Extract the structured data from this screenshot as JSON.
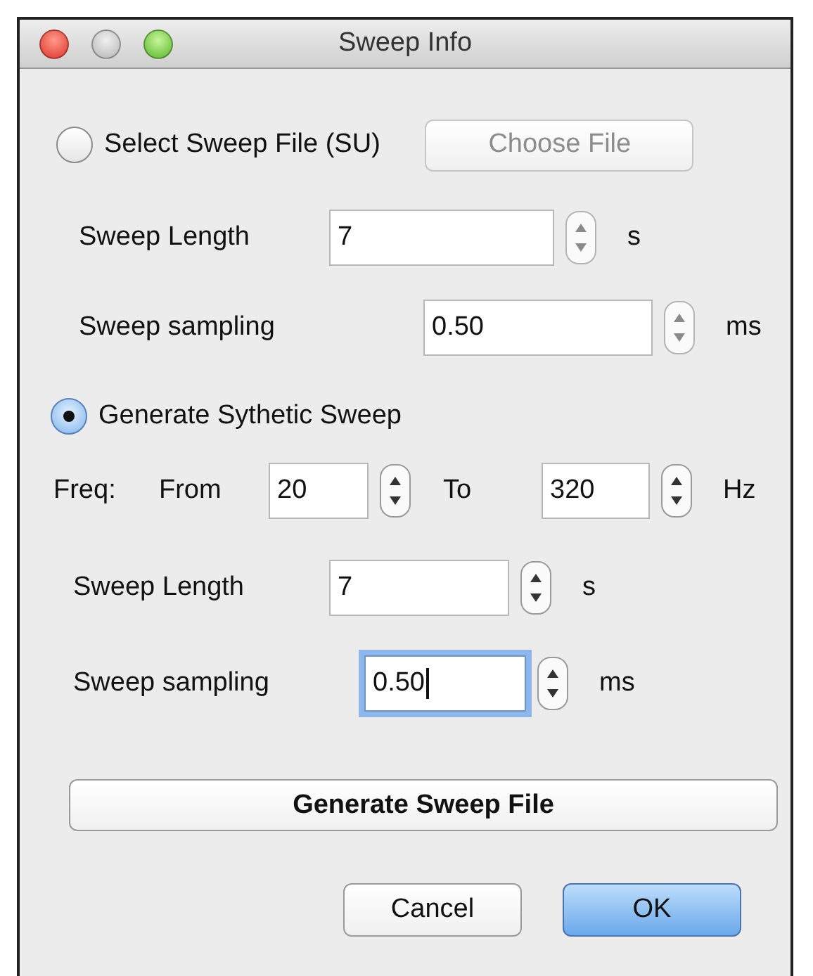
{
  "window": {
    "title": "Sweep Info"
  },
  "file_option": {
    "label": "Select Sweep File (SU)",
    "selected": false,
    "button": {
      "label": "Choose File",
      "disabled": true
    }
  },
  "file_fields": [
    {
      "label": "Sweep Length",
      "value": "7",
      "unit": "s",
      "focused": false
    },
    {
      "label": "Sweep sampling",
      "value": "0.50",
      "unit": "ms",
      "focused": false
    }
  ],
  "synthetic_option": {
    "label": "Generate Sythetic Sweep",
    "selected": true
  },
  "freq": {
    "label": "Freq:",
    "from_label": "From",
    "from_value": "20",
    "to_label": "To",
    "to_value": "320",
    "unit": "Hz"
  },
  "synthetic_fields": [
    {
      "label": "Sweep Length",
      "value": "7",
      "unit": "s",
      "focused": false
    },
    {
      "label": "Sweep sampling",
      "value": "0.50",
      "unit": "ms",
      "focused": true
    }
  ],
  "generate_button": {
    "label": "Generate Sweep File"
  },
  "buttons": [
    {
      "label": "Cancel",
      "default": false
    },
    {
      "label": "OK",
      "default": true
    }
  ]
}
